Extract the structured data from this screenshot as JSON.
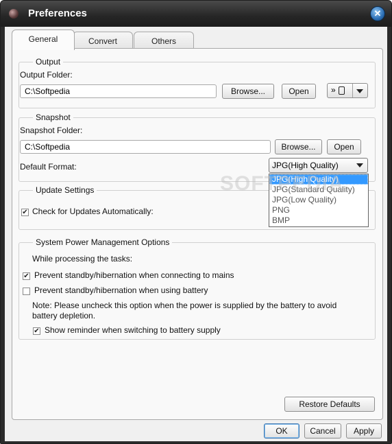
{
  "window": {
    "title": "Preferences"
  },
  "tabs": [
    {
      "label": "General",
      "active": true
    },
    {
      "label": "Convert",
      "active": false
    },
    {
      "label": "Others",
      "active": false
    }
  ],
  "output": {
    "group_title": "Output",
    "folder_label": "Output Folder:",
    "folder_value": "C:\\Softpedia",
    "browse_label": "Browse...",
    "open_label": "Open",
    "device_icon": "double-chevron-device-icon"
  },
  "snapshot": {
    "group_title": "Snapshot",
    "folder_label": "Snapshot Folder:",
    "folder_value": "C:\\Softpedia",
    "browse_label": "Browse...",
    "open_label": "Open",
    "format_label": "Default Format:",
    "format_selected": "JPG(High Quality)",
    "format_options": [
      "JPG(High Quality)",
      "JPG(Standard Quality)",
      "JPG(Low Quality)",
      "PNG",
      "BMP"
    ]
  },
  "update": {
    "group_title": "Update Settings",
    "check_label": "Check for Updates Automatically:",
    "checked": true
  },
  "power": {
    "group_title": "System Power Management Options",
    "intro": "While processing the tasks:",
    "opt_mains": "Prevent standby/hibernation when connecting to mains",
    "opt_mains_checked": true,
    "opt_battery": "Prevent standby/hibernation when using battery",
    "opt_battery_checked": false,
    "note_line1": "Note: Please uncheck this option when the power is supplied by the battery to avoid",
    "note_line2": "battery depletion.",
    "opt_reminder": "Show reminder when switching to battery supply",
    "opt_reminder_checked": true
  },
  "watermark": "SOFTPEDIA",
  "buttons": {
    "restore": "Restore Defaults",
    "ok": "OK",
    "cancel": "Cancel",
    "apply": "Apply"
  },
  "colors": {
    "selection": "#3399ff",
    "title_bar": "#262626"
  }
}
